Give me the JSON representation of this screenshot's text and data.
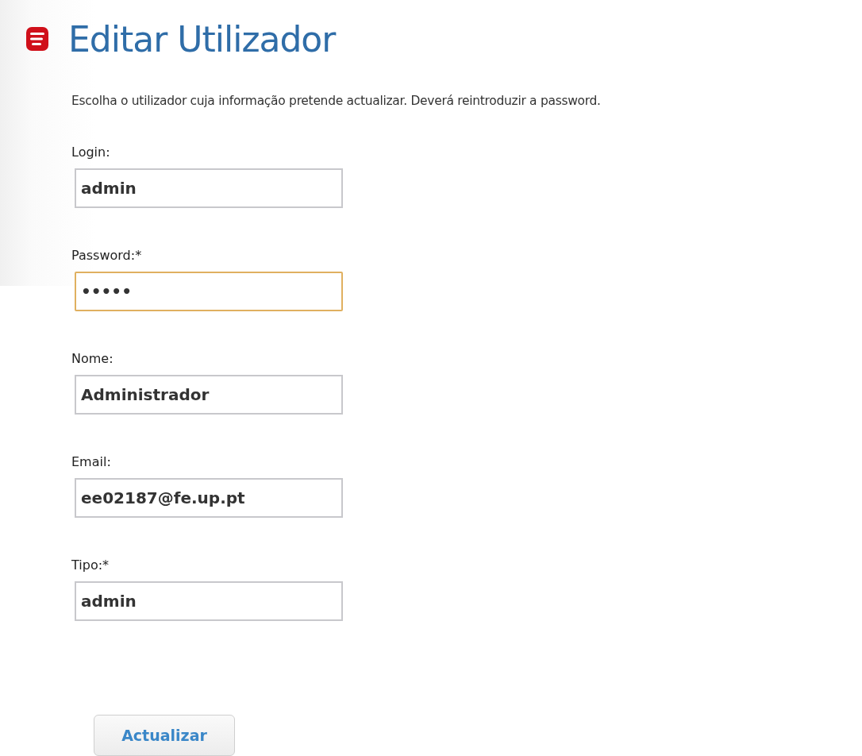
{
  "title": "Editar Utilizador",
  "description": "Escolha o utilizador cuja informação pretende actualizar. Deverá reintroduzir a password.",
  "fields": [
    {
      "label": "Login:",
      "value": "admin",
      "focused": false
    },
    {
      "label": "Password:*",
      "value": "•••••",
      "focused": true
    },
    {
      "label": "Nome:",
      "value": "Administrador",
      "focused": false
    },
    {
      "label": "Email:",
      "value": "ee02187@fe.up.pt",
      "focused": false
    },
    {
      "label": "Tipo:*",
      "value": "admin",
      "focused": false
    }
  ],
  "button": "Actualizar"
}
